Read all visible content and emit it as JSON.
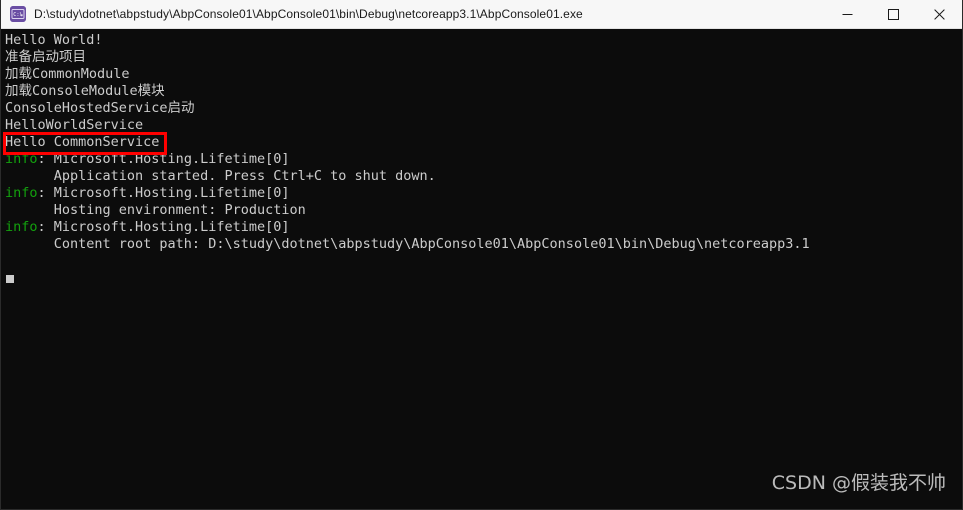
{
  "window": {
    "title": "D:\\study\\dotnet\\abpstudy\\AbpConsole01\\AbpConsole01\\bin\\Debug\\netcoreapp3.1\\AbpConsole01.exe",
    "icon_name": "console-app-icon",
    "icon_glyph": "C:\\",
    "background_color": "#0c0c0c",
    "titlebar_color": "#f7f7f7",
    "controls": {
      "minimize_label": "Minimize",
      "maximize_label": "Maximize",
      "close_label": "Close"
    }
  },
  "console": {
    "foreground_color": "#cccccc",
    "info_color": "#13a10e",
    "lines": [
      {
        "text": "Hello World!",
        "type": "plain"
      },
      {
        "text": "准备启动项目",
        "type": "plain"
      },
      {
        "text": "加载CommonModule",
        "type": "plain"
      },
      {
        "text": "加载ConsoleModule模块",
        "type": "plain"
      },
      {
        "text": "ConsoleHostedService启动",
        "type": "plain"
      },
      {
        "text": "HelloWorldService",
        "type": "plain"
      },
      {
        "text": "Hello CommonService",
        "type": "plain"
      },
      {
        "prefix": "info",
        "text": ": Microsoft.Hosting.Lifetime[0]",
        "type": "info"
      },
      {
        "text": "      Application started. Press Ctrl+C to shut down.",
        "type": "plain"
      },
      {
        "prefix": "info",
        "text": ": Microsoft.Hosting.Lifetime[0]",
        "type": "info"
      },
      {
        "text": "      Hosting environment: Production",
        "type": "plain"
      },
      {
        "prefix": "info",
        "text": ": Microsoft.Hosting.Lifetime[0]",
        "type": "info"
      },
      {
        "text": "      Content root path: D:\\study\\dotnet\\abpstudy\\AbpConsole01\\AbpConsole01\\bin\\Debug\\netcoreapp3.1",
        "type": "plain"
      }
    ]
  },
  "annotation": {
    "color": "#ff0000",
    "target_text": "Hello CommonService"
  },
  "watermark": {
    "text": "CSDN @假装我不帅"
  }
}
